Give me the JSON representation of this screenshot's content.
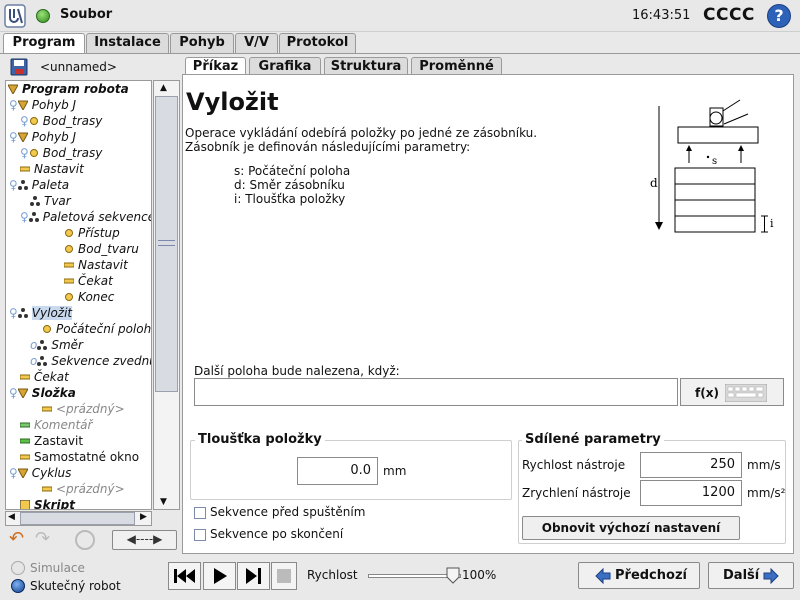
{
  "header": {
    "file_label": "Soubor",
    "clock": "16:43:51",
    "robot_name": "CCCC",
    "help_label": "?"
  },
  "main_tabs": [
    {
      "label": "Program"
    },
    {
      "label": "Instalace"
    },
    {
      "label": "Pohyb"
    },
    {
      "label": "V/V"
    },
    {
      "label": "Protokol"
    }
  ],
  "program_name": "<unnamed>",
  "tree": [
    {
      "label": "Program robota"
    },
    {
      "label": "Pohyb J"
    },
    {
      "label": "Bod_trasy"
    },
    {
      "label": "Pohyb J"
    },
    {
      "label": "Bod_trasy"
    },
    {
      "label": "Nastavit"
    },
    {
      "label": "Paleta"
    },
    {
      "label": "Tvar"
    },
    {
      "label": "Paletová sekvence"
    },
    {
      "label": "Přístup"
    },
    {
      "label": "Bod_tvaru"
    },
    {
      "label": "Nastavit"
    },
    {
      "label": "Čekat"
    },
    {
      "label": "Konec"
    },
    {
      "label": "Vyložit"
    },
    {
      "label": "Počáteční poloha"
    },
    {
      "label": "Směr"
    },
    {
      "label": "Sekvence zvednutí"
    },
    {
      "label": "Čekat"
    },
    {
      "label": "Složka"
    },
    {
      "label": "<prázdný>"
    },
    {
      "label": "Komentář"
    },
    {
      "label": "Zastavit"
    },
    {
      "label": "Samostatné okno"
    },
    {
      "label": "Cyklus"
    },
    {
      "label": "<prázdný>"
    },
    {
      "label": "Skript"
    }
  ],
  "content_tabs": [
    {
      "label": "Příkaz"
    },
    {
      "label": "Grafika"
    },
    {
      "label": "Struktura"
    },
    {
      "label": "Proměnné"
    }
  ],
  "command": {
    "title": "Vyložit",
    "desc1": "Operace vykládání odebírá položky po jedné ze zásobníku.",
    "desc2": "Zásobník je definován následujícími parametry:",
    "param_s": "s: Počáteční poloha",
    "param_d": "d: Směr zásobníku",
    "param_i": "i: Tloušťka položky",
    "diagram": {
      "s": "s",
      "d": "d",
      "i": "i"
    },
    "next_pos_label": "Další poloha bude nalezena, když:",
    "next_pos_value": "",
    "fx_label": "f(x)",
    "thickness_title": "Tloušťka položky",
    "thickness_value": "0.0",
    "thickness_unit": "mm",
    "shared_title": "Sdílené parametry",
    "tool_speed_label": "Rychlost nástroje",
    "tool_speed_value": "250",
    "tool_speed_unit": "mm/s",
    "tool_accel_label": "Zrychlení nástroje",
    "tool_accel_value": "1200",
    "tool_accel_unit": "mm/s²",
    "reset_label": "Obnovit výchozí nastavení",
    "seq_before_label": "Sekvence před spuštěním",
    "seq_after_label": "Sekvence po skončení"
  },
  "footer": {
    "simulation_label": "Simulace",
    "real_robot_label": "Skutečný robot",
    "speed_label": "Rychlost",
    "speed_value": "100%",
    "speed_fraction": 1.0,
    "prev_label": "Předchozí",
    "next_label": "Další"
  },
  "colors": {
    "accent_blue": "#2e62b8",
    "play_green": "#2c8a1a",
    "tree_select": "#c9d9ee"
  }
}
